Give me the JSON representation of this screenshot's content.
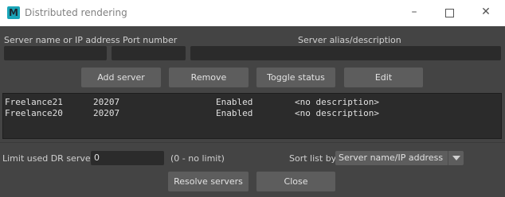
{
  "window": {
    "title": "Distributed rendering",
    "icon_letter": "M"
  },
  "form": {
    "server_label": "Server name or IP address",
    "port_label": "Port number",
    "alias_label": "Server alias/description",
    "server_value": "",
    "port_value": "",
    "alias_value": ""
  },
  "toolbar": {
    "add_label": "Add server",
    "remove_label": "Remove",
    "toggle_label": "Toggle status",
    "edit_label": "Edit"
  },
  "servers": [
    {
      "name": "Freelance21",
      "port": "20207",
      "status": "Enabled",
      "description": "<no description>"
    },
    {
      "name": "Freelance20",
      "port": "20207",
      "status": "Enabled",
      "description": "<no description>"
    }
  ],
  "bottom": {
    "limit_label": "Limit used DR servers",
    "limit_value": "0",
    "limit_hint": "(0 - no limit)",
    "sort_label": "Sort list by",
    "sort_value": "Server name/IP address",
    "resolve_label": "Resolve servers",
    "close_label": "Close"
  }
}
